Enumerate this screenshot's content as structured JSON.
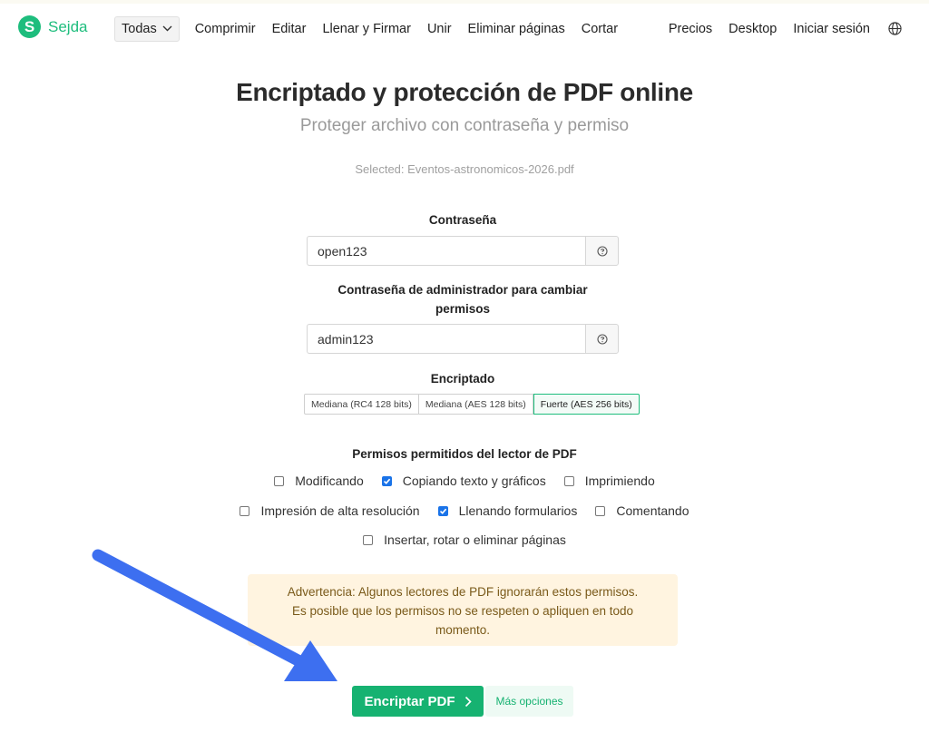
{
  "nav": {
    "logo_letter": "S",
    "logo_text": "Sejda",
    "todas": "Todas",
    "items": [
      "Comprimir",
      "Editar",
      "Llenar y Firmar",
      "Unir",
      "Eliminar páginas",
      "Cortar"
    ],
    "right_items": [
      "Precios",
      "Desktop",
      "Iniciar sesión"
    ]
  },
  "header": {
    "title": "Encriptado y protección de PDF online",
    "subtitle": "Proteger archivo con contraseña y permiso",
    "selected": "Selected: Eventos-astronomicos-2026.pdf"
  },
  "form": {
    "password_label": "Contraseña",
    "password_value": "open123",
    "admin_label_1": "Contraseña de administrador para cambiar",
    "admin_label_2": "permisos",
    "admin_value": "admin123",
    "encryption_label": "Encriptado",
    "encryption_options": [
      "Mediana (RC4 128 bits)",
      "Mediana (AES 128 bits)",
      "Fuerte (AES 256 bits)"
    ],
    "encryption_selected": "Fuerte (AES 256 bits)",
    "permissions_label": "Permisos permitidos del lector de PDF",
    "permissions": [
      {
        "label": "Modificando",
        "checked": false
      },
      {
        "label": "Copiando texto y gráficos",
        "checked": true
      },
      {
        "label": "Imprimiendo",
        "checked": false
      },
      {
        "label": "Impresión de alta resolución",
        "checked": false
      },
      {
        "label": "Llenando formularios",
        "checked": true
      },
      {
        "label": "Comentando",
        "checked": false
      },
      {
        "label": "Insertar, rotar o eliminar páginas",
        "checked": false
      }
    ]
  },
  "warning": {
    "line1": "Advertencia: Algunos lectores de PDF ignorarán estos permisos.",
    "line2": "Es posible que los permisos no se respeten o apliquen en todo",
    "line3": "momento."
  },
  "actions": {
    "encrypt_label": "Encriptar PDF",
    "more_label": "Más opciones"
  },
  "colors": {
    "brand": "#1ebd7d",
    "arrow": "#3d6ff0",
    "checkbox": "#1a73e8"
  }
}
